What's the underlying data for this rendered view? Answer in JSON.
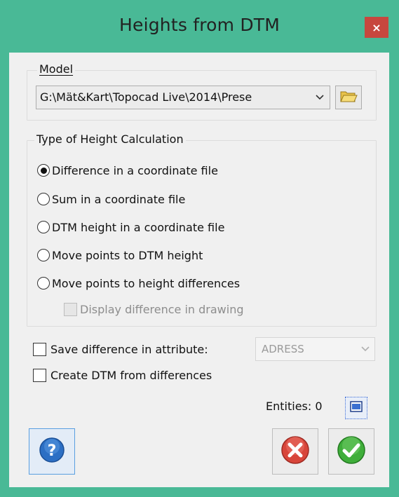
{
  "window": {
    "title": "Heights from DTM",
    "close_label": "×"
  },
  "model": {
    "group_label": "Model",
    "path_value": "G:\\Mät&Kart\\Topocad Live\\2014\\Prese",
    "browse_icon": "folder-icon"
  },
  "height_calc": {
    "group_label": "Type of Height Calculation",
    "options": [
      {
        "label": "Difference in a coordinate file",
        "selected": true
      },
      {
        "label": "Sum in a coordinate file",
        "selected": false
      },
      {
        "label": "DTM height in a coordinate file",
        "selected": false
      },
      {
        "label": "Move points to DTM height",
        "selected": false
      },
      {
        "label": "Move points to height differences",
        "selected": false
      }
    ],
    "display_diff_label": "Display difference in drawing",
    "display_diff_enabled": false
  },
  "save_attr": {
    "label": "Save difference in attribute:",
    "checked": false,
    "attribute_value": "ADRESS",
    "enabled": false
  },
  "create_dtm": {
    "label": "Create DTM from differences",
    "checked": false
  },
  "entities": {
    "label": "Entities: 0"
  },
  "buttons": {
    "help_icon": "help-icon",
    "cancel_icon": "cancel-icon",
    "ok_icon": "ok-icon"
  },
  "colors": {
    "frame": "#49b996",
    "close": "#c7473e",
    "cancel_red": "#d8453a",
    "ok_green": "#3fae3a",
    "help_blue": "#2c6fc4"
  }
}
